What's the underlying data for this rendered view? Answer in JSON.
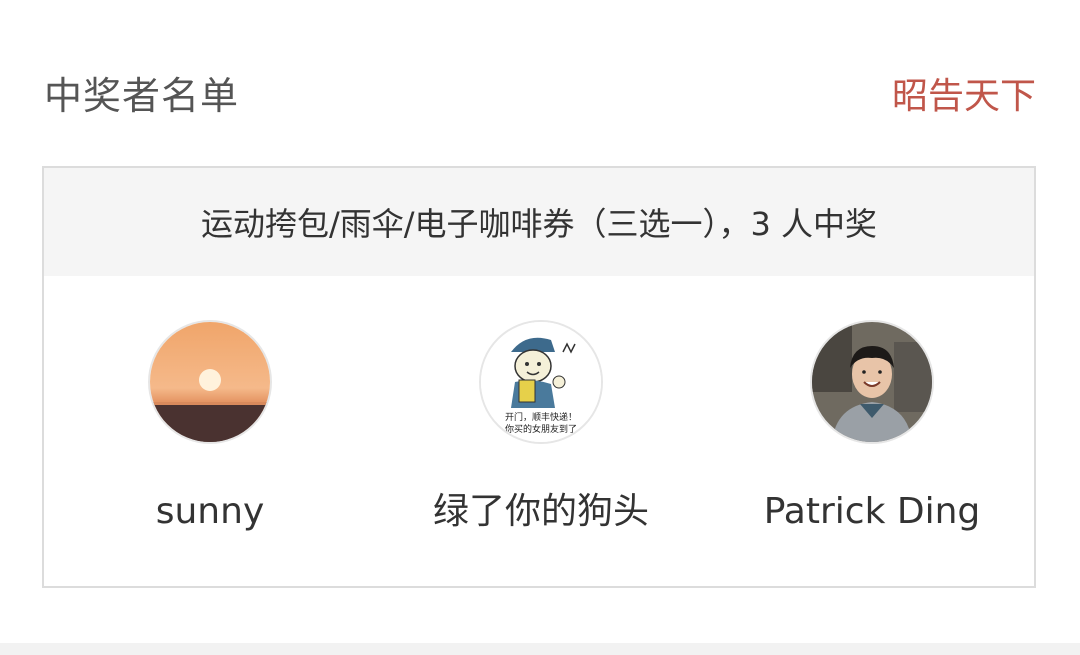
{
  "header": {
    "title": "中奖者名单",
    "share_label": "昭告天下"
  },
  "prize": {
    "description": "运动挎包/雨伞/电子咖啡券（三选一），3 人中奖"
  },
  "winners": [
    {
      "name": "sunny",
      "avatar_icon": "sunset-avatar"
    },
    {
      "name": "绿了你的狗头",
      "avatar_icon": "meme-avatar",
      "avatar_text": [
        "开门，顺丰快递！",
        "你买的女朋友到了"
      ]
    },
    {
      "name": "Patrick Ding",
      "avatar_icon": "person-photo-avatar"
    }
  ],
  "colors": {
    "title": "#555555",
    "accent": "#c0564a",
    "banner_bg": "#f5f5f5",
    "border": "#dcdcdc"
  }
}
